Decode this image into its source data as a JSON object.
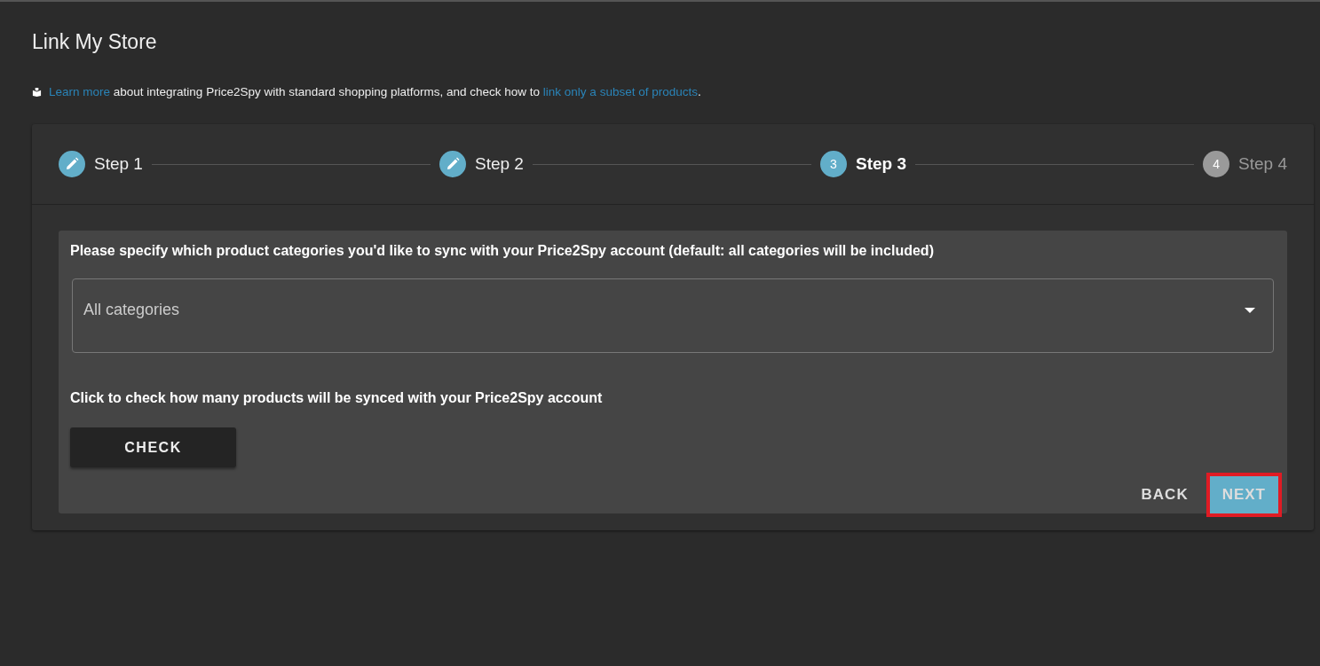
{
  "page": {
    "title": "Link My Store"
  },
  "info": {
    "link_1": "Learn more",
    "text_1": " about integrating Price2Spy with standard shopping platforms, and check how to ",
    "link_2": "link only a subset of products",
    "text_2": "."
  },
  "steps": [
    {
      "label": "Step 1",
      "completed": true,
      "selected": false
    },
    {
      "label": "Step 2",
      "completed": true,
      "selected": false
    },
    {
      "label": "Step 3",
      "number": "3",
      "completed": false,
      "selected": true
    },
    {
      "label": "Step 4",
      "number": "4",
      "completed": false,
      "selected": false
    }
  ],
  "form": {
    "instruction": "Please specify which product categories you'd like to sync with your Price2Spy account (default: all categories will be included)",
    "category_select": {
      "value": "All categories"
    },
    "check_text": "Click to check how many products will be synced with your Price2Spy account",
    "check_button": "CHECK"
  },
  "buttons": [
    {
      "label": "BACK",
      "kind": "text",
      "highlighted": false
    },
    {
      "label": "NEXT",
      "kind": "primary",
      "highlighted": true
    }
  ]
}
